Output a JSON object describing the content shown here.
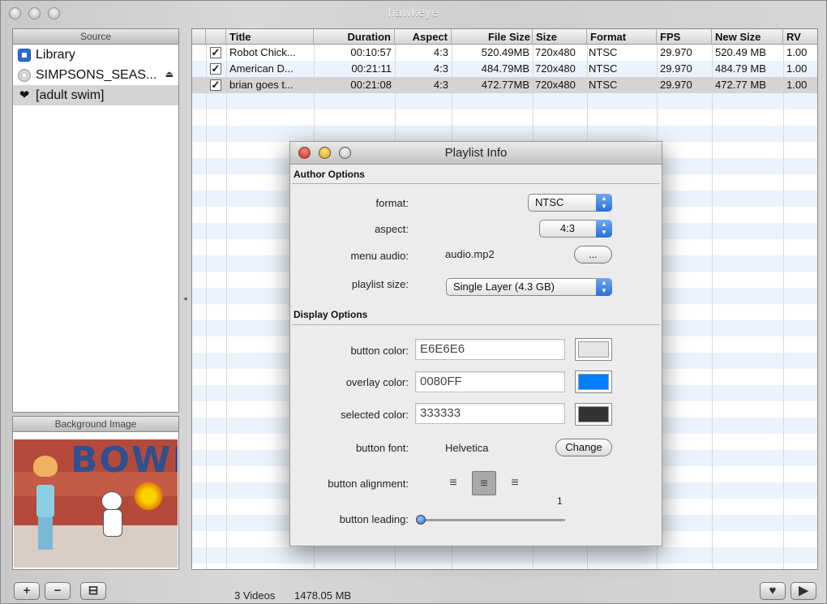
{
  "window": {
    "title": "hawkeye"
  },
  "source_panel": {
    "header": "Source",
    "items": [
      {
        "label": "Library",
        "icon": "library-icon"
      },
      {
        "label": "SIMPSONS_SEAS...",
        "icon": "dvd-icon",
        "eject": "⏏"
      },
      {
        "label": "[adult swim]",
        "icon": "heart-icon"
      }
    ]
  },
  "background_panel": {
    "header": "Background Image",
    "art_text": "BOWL"
  },
  "table": {
    "headers": [
      "Title",
      "Duration",
      "Aspect",
      "File Size",
      "Size",
      "Format",
      "FPS",
      "New Size",
      "RV"
    ],
    "rows": [
      {
        "checked": "✓",
        "title": "Robot Chick...",
        "duration": "00:10:57",
        "aspect": "4:3",
        "file_size": "520.49MB",
        "size": "720x480",
        "format": "NTSC",
        "fps": "29.970",
        "new_size": "520.49 MB",
        "rv": "1.00"
      },
      {
        "checked": "✓",
        "title": "American D...",
        "duration": "00:21:11",
        "aspect": "4:3",
        "file_size": "484.79MB",
        "size": "720x480",
        "format": "NTSC",
        "fps": "29.970",
        "new_size": "484.79 MB",
        "rv": "1.00"
      },
      {
        "checked": "✓",
        "title": "brian goes t...",
        "duration": "00:21:08",
        "aspect": "4:3",
        "file_size": "472.77MB",
        "size": "720x480",
        "format": "NTSC",
        "fps": "29.970",
        "new_size": "472.77 MB",
        "rv": "1.00"
      }
    ]
  },
  "bottom_bar": {
    "add": "+",
    "remove": "−",
    "archive": "⊟",
    "videos_count": "3 Videos",
    "total_size": "1478.05 MB",
    "burn": "♥",
    "play": "▶"
  },
  "dialog": {
    "title": "Playlist Info",
    "author_section": "Author Options",
    "format_label": "format:",
    "format_value": "NTSC",
    "aspect_label": "aspect:",
    "aspect_value": "4:3",
    "menu_audio_label": "menu audio:",
    "menu_audio_value": "audio.mp2",
    "browse_label": "...",
    "playlist_size_label": "playlist size:",
    "playlist_size_value": "Single Layer (4.3 GB)",
    "display_section": "Display Options",
    "button_color_label": "button color:",
    "button_color_value": "E6E6E6",
    "overlay_color_label": "overlay color:",
    "overlay_color_value": "0080FF",
    "selected_color_label": "selected color:",
    "selected_color_value": "333333",
    "button_font_label": "button font:",
    "button_font_value": "Helvetica",
    "change_label": "Change",
    "button_alignment_label": "button alignment:",
    "button_leading_label": "button leading:",
    "button_leading_value": "1",
    "alignment_icons": [
      "≡",
      "≡",
      "≡"
    ]
  },
  "colors": {
    "button": "#E6E6E6",
    "overlay": "#0080FF",
    "selected": "#333333",
    "selection_row": "#d4d4d4"
  }
}
